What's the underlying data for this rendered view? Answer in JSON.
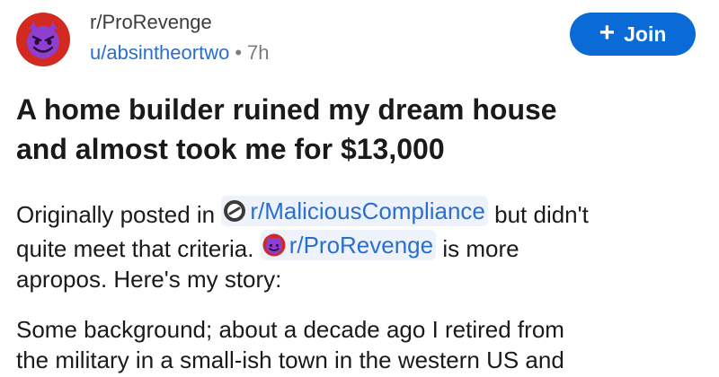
{
  "post": {
    "subreddit": "r/ProRevenge",
    "username": "u/absintheortwo",
    "separator": "•",
    "time": "7h",
    "join_label": "Join",
    "join_icon": "plus-icon",
    "title_line1": "A home builder ruined my dream house",
    "title_line2": "and almost took me for $13,000"
  },
  "body": {
    "p1_part1": "Originally posted in ",
    "p1_link1": "r/MaliciousCompliance",
    "p1_part2": " but didn't",
    "p1_part3": "quite meet that criteria. ",
    "p1_link2": "r/ProRevenge",
    "p1_part4": " is more",
    "p1_part5": "apropos.  Here's my story:",
    "p2_line1": "Some  background; about a decade ago I retired from",
    "p2_line2": "the military in a  small-ish town in the western US and"
  },
  "colors": {
    "accent": "#0a6ad6",
    "link": "#2a6fcf",
    "avatar_bg": "#d22a20",
    "devil_purple": "#8e3fd0"
  },
  "icons": {
    "avatar": "devil-face-icon",
    "malicious_compliance": "compliance-icon",
    "prorevenge": "devil-face-icon"
  }
}
